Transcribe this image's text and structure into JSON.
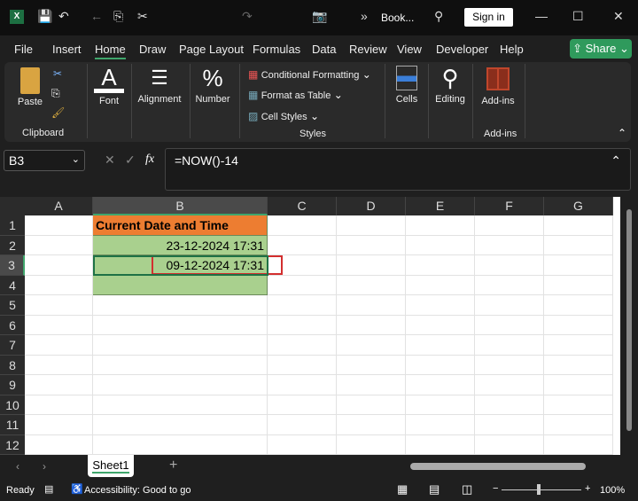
{
  "title_bar": {
    "doc_name": "Book...",
    "sign_in": "Sign in"
  },
  "menu": [
    "File",
    "Insert",
    "Home",
    "Draw",
    "Page Layout",
    "Formulas",
    "Data",
    "Review",
    "View",
    "Developer",
    "Help"
  ],
  "share": "Share",
  "ribbon": {
    "paste": "Paste",
    "clipboard": "Clipboard",
    "font": "Font",
    "alignment": "Alignment",
    "number": "Number",
    "conditional_formatting": "Conditional Formatting",
    "format_as_table": "Format as Table",
    "cell_styles": "Cell Styles",
    "styles": "Styles",
    "cells": "Cells",
    "editing": "Editing",
    "addins": "Add-ins",
    "addins_group": "Add-ins"
  },
  "formula_bar": {
    "name_box": "B3",
    "fx": "fx",
    "formula": "=NOW()-14"
  },
  "columns": [
    "A",
    "B",
    "C",
    "D",
    "E",
    "F",
    "G"
  ],
  "rows": [
    "1",
    "2",
    "3",
    "4",
    "5",
    "6",
    "7",
    "8",
    "9",
    "10",
    "11",
    "12"
  ],
  "cells": {
    "B1": "Current Date and Time",
    "B2": "23-12-2024 17:31",
    "B3": "09-12-2024 17:31"
  },
  "colors": {
    "header_fill": "#ed7d31",
    "data_fill": "#a9d08e",
    "highlight_border": "#d32f2f",
    "accent": "#3fa66c"
  },
  "sheet_tab": "Sheet1",
  "status": {
    "ready": "Ready",
    "accessibility": "Accessibility: Good to go",
    "zoom": "100%"
  }
}
